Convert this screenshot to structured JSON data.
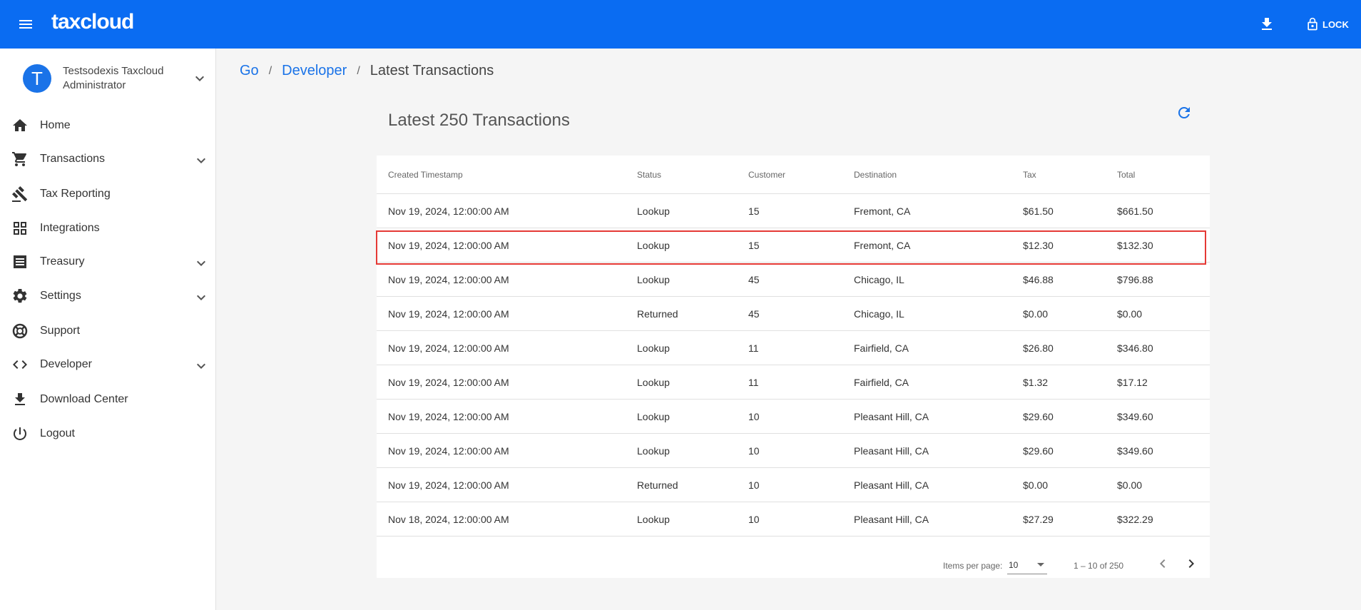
{
  "header": {
    "brand": "taxcloud",
    "lock_label": "LOCK"
  },
  "user": {
    "initial": "T",
    "name": "Testsodexis Taxcloud Administrator"
  },
  "sidebar": {
    "items": [
      {
        "label": "Home",
        "icon": "home-icon",
        "expandable": false
      },
      {
        "label": "Transactions",
        "icon": "cart-icon",
        "expandable": true
      },
      {
        "label": "Tax Reporting",
        "icon": "gavel-icon",
        "expandable": false
      },
      {
        "label": "Integrations",
        "icon": "grid-icon",
        "expandable": false
      },
      {
        "label": "Treasury",
        "icon": "receipt-icon",
        "expandable": true
      },
      {
        "label": "Settings",
        "icon": "gear-icon",
        "expandable": true
      },
      {
        "label": "Support",
        "icon": "lifebuoy-icon",
        "expandable": false
      },
      {
        "label": "Developer",
        "icon": "code-icon",
        "expandable": true
      },
      {
        "label": "Download Center",
        "icon": "download-icon",
        "expandable": false
      },
      {
        "label": "Logout",
        "icon": "power-icon",
        "expandable": false
      }
    ]
  },
  "breadcrumb": {
    "items": [
      "Go",
      "Developer"
    ],
    "current": "Latest Transactions",
    "separator": "/"
  },
  "main": {
    "heading": "Latest 250 Transactions"
  },
  "table": {
    "columns": [
      "Created Timestamp",
      "Status",
      "Customer",
      "Destination",
      "Tax",
      "Total"
    ],
    "rows": [
      [
        "Nov 19, 2024, 12:00:00 AM",
        "Lookup",
        "15",
        "Fremont, CA",
        "$61.50",
        "$661.50"
      ],
      [
        "Nov 19, 2024, 12:00:00 AM",
        "Lookup",
        "15",
        "Fremont, CA",
        "$12.30",
        "$132.30"
      ],
      [
        "Nov 19, 2024, 12:00:00 AM",
        "Lookup",
        "45",
        "Chicago, IL",
        "$46.88",
        "$796.88"
      ],
      [
        "Nov 19, 2024, 12:00:00 AM",
        "Returned",
        "45",
        "Chicago, IL",
        "$0.00",
        "$0.00"
      ],
      [
        "Nov 19, 2024, 12:00:00 AM",
        "Lookup",
        "11",
        "Fairfield, CA",
        "$26.80",
        "$346.80"
      ],
      [
        "Nov 19, 2024, 12:00:00 AM",
        "Lookup",
        "11",
        "Fairfield, CA",
        "$1.32",
        "$17.12"
      ],
      [
        "Nov 19, 2024, 12:00:00 AM",
        "Lookup",
        "10",
        "Pleasant Hill, CA",
        "$29.60",
        "$349.60"
      ],
      [
        "Nov 19, 2024, 12:00:00 AM",
        "Lookup",
        "10",
        "Pleasant Hill, CA",
        "$29.60",
        "$349.60"
      ],
      [
        "Nov 19, 2024, 12:00:00 AM",
        "Returned",
        "10",
        "Pleasant Hill, CA",
        "$0.00",
        "$0.00"
      ],
      [
        "Nov 18, 2024, 12:00:00 AM",
        "Lookup",
        "10",
        "Pleasant Hill, CA",
        "$27.29",
        "$322.29"
      ]
    ],
    "highlighted_row": 1
  },
  "paginator": {
    "items_per_page_label": "Items per page:",
    "items_per_page_value": "10",
    "range_label": "1 – 10 of 250"
  },
  "colors": {
    "topbar": "#0a6cf2",
    "link": "#1a73e8",
    "highlight": "#e53935"
  }
}
